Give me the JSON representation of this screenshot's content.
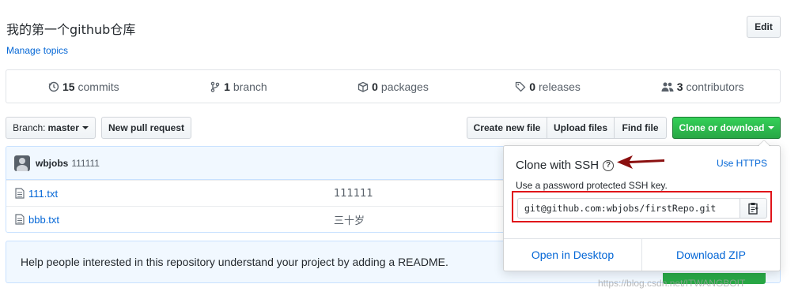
{
  "repo": {
    "description": "我的第一个github仓库",
    "manage_topics": "Manage topics",
    "edit_label": "Edit"
  },
  "numbers": [
    {
      "icon": "history-icon",
      "count": "15",
      "label": "commits"
    },
    {
      "icon": "git-branch-icon",
      "count": "1",
      "label": "branch"
    },
    {
      "icon": "package-icon",
      "count": "0",
      "label": "packages"
    },
    {
      "icon": "tag-icon",
      "count": "0",
      "label": "releases"
    },
    {
      "icon": "people-icon",
      "count": "3",
      "label": "contributors"
    }
  ],
  "toolbar": {
    "branch_prefix": "Branch:",
    "branch_name": "master",
    "new_pull_request": "New pull request",
    "create_new_file": "Create new file",
    "upload_files": "Upload files",
    "find_file": "Find file",
    "clone_or_download": "Clone or download"
  },
  "latest_commit": {
    "author": "wbjobs",
    "message": "111111"
  },
  "files": [
    {
      "name": "111.txt",
      "commit": "111111"
    },
    {
      "name": "bbb.txt",
      "commit": "三十岁"
    }
  ],
  "readme_prompt": "Help people interested in this repository understand your project by adding a README.",
  "clone_panel": {
    "title": "Clone with SSH",
    "use_https": "Use HTTPS",
    "subtitle": "Use a password protected SSH key.",
    "url": "git@github.com:wbjobs/firstRepo.git",
    "open_desktop": "Open in Desktop",
    "download_zip": "Download ZIP"
  },
  "watermark": "https://blog.csdn.net/ITWANGBOIT",
  "colors": {
    "link": "#0366d6",
    "primary_green": "#28a745",
    "annotation_red": "#e0141a",
    "annotation_arrow": "#8b1010"
  }
}
